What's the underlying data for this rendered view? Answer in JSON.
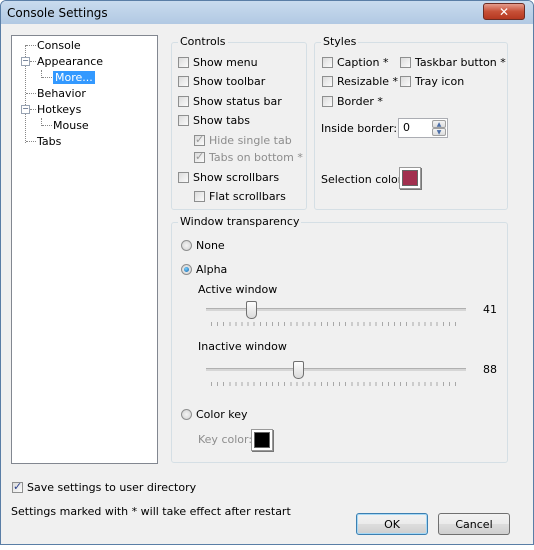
{
  "window": {
    "title": "Console Settings",
    "close_label": "✕"
  },
  "tree": {
    "items": [
      {
        "label": "Console",
        "level": 0
      },
      {
        "label": "Appearance",
        "level": 0,
        "expanded": true
      },
      {
        "label": "More...",
        "level": 1,
        "selected": true
      },
      {
        "label": "Behavior",
        "level": 0
      },
      {
        "label": "Hotkeys",
        "level": 0,
        "expanded": true
      },
      {
        "label": "Mouse",
        "level": 1
      },
      {
        "label": "Tabs",
        "level": 0
      }
    ],
    "expander_symbol": "−"
  },
  "controls": {
    "title": "Controls",
    "items": [
      {
        "label": "Show menu",
        "checked": false,
        "enabled": true
      },
      {
        "label": "Show toolbar",
        "checked": false,
        "enabled": true
      },
      {
        "label": "Show status bar",
        "checked": false,
        "enabled": true
      },
      {
        "label": "Show tabs",
        "checked": false,
        "enabled": true
      },
      {
        "label": "Hide single tab",
        "checked": true,
        "enabled": false
      },
      {
        "label": "Tabs on bottom *",
        "checked": true,
        "enabled": false
      },
      {
        "label": "Show scrollbars",
        "checked": false,
        "enabled": true
      },
      {
        "label": "Flat scrollbars",
        "checked": false,
        "enabled": true
      }
    ]
  },
  "styles": {
    "title": "Styles",
    "items": [
      {
        "label": "Caption *",
        "checked": false
      },
      {
        "label": "Taskbar button *",
        "checked": false
      },
      {
        "label": "Resizable *",
        "checked": false
      },
      {
        "label": "Tray icon",
        "checked": false
      },
      {
        "label": "Border *",
        "checked": false
      }
    ],
    "inside_border_label": "Inside border:",
    "inside_border_value": "0",
    "spin_up": "▲",
    "spin_down": "▼",
    "selection_color_label": "Selection color:",
    "selection_color": "#a2304f"
  },
  "transparency": {
    "title": "Window transparency",
    "options": [
      {
        "label": "None",
        "selected": false
      },
      {
        "label": "Alpha",
        "selected": true
      },
      {
        "label": "Color key",
        "selected": false
      }
    ],
    "active_label": "Active window",
    "active_value": "41",
    "active_fraction": 0.16,
    "inactive_label": "Inactive window",
    "inactive_value": "88",
    "inactive_fraction": 0.35,
    "key_color_label": "Key color:",
    "key_color": "#000000"
  },
  "footer": {
    "save_label": "Save settings to user directory",
    "save_checked": true,
    "note": "Settings marked with * will take effect after restart",
    "ok_label": "OK",
    "cancel_label": "Cancel"
  }
}
